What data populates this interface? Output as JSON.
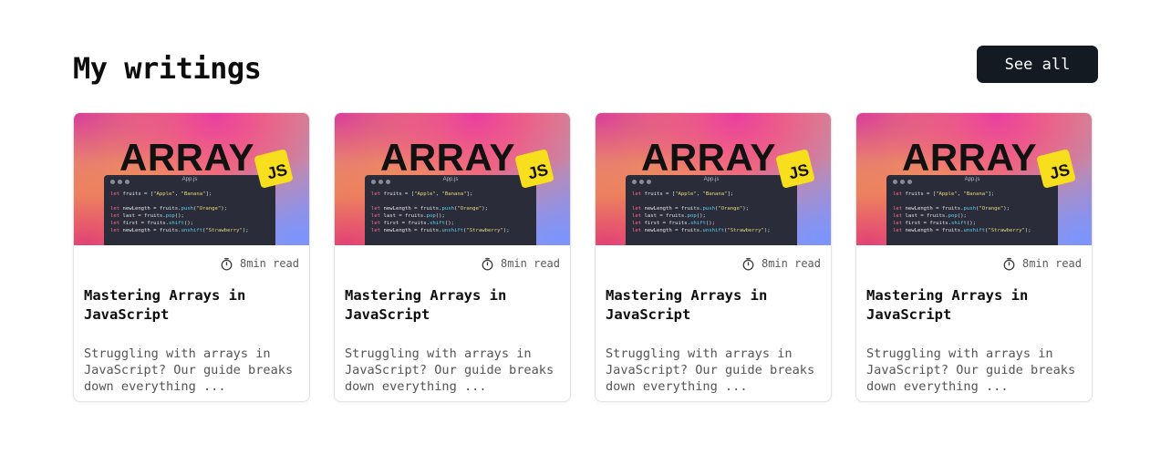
{
  "section": {
    "title": "My writings",
    "see_all_label": "See all"
  },
  "cards": [
    {
      "thumbnail": {
        "heading": "ARRAY",
        "badge": "JS",
        "filename": "App.js",
        "code": [
          "let fruits = [\"Apple\", \"Banana\"];",
          "",
          "let newLength = fruits.push(\"Orange\");",
          "let last = fruits.pop();",
          "let first = fruits.shift();",
          "let newLength = fruits.unshift(\"Strawberry\");"
        ]
      },
      "read_time": "8min read",
      "title": "Mastering Arrays in JavaScript",
      "description": "Struggling with arrays in JavaScript? Our guide breaks down everything ..."
    },
    {
      "thumbnail": {
        "heading": "ARRAY",
        "badge": "JS",
        "filename": "App.js",
        "code": [
          "let fruits = [\"Apple\", \"Banana\"];",
          "",
          "let newLength = fruits.push(\"Orange\");",
          "let last = fruits.pop();",
          "let first = fruits.shift();",
          "let newLength = fruits.unshift(\"Strawberry\");"
        ]
      },
      "read_time": "8min read",
      "title": "Mastering Arrays in JavaScript",
      "description": "Struggling with arrays in JavaScript? Our guide breaks down everything ..."
    },
    {
      "thumbnail": {
        "heading": "ARRAY",
        "badge": "JS",
        "filename": "App.js",
        "code": [
          "let fruits = [\"Apple\", \"Banana\"];",
          "",
          "let newLength = fruits.push(\"Orange\");",
          "let last = fruits.pop();",
          "let first = fruits.shift();",
          "let newLength = fruits.unshift(\"Strawberry\");"
        ]
      },
      "read_time": "8min read",
      "title": "Mastering Arrays in JavaScript",
      "description": "Struggling with arrays in JavaScript? Our guide breaks down everything ..."
    },
    {
      "thumbnail": {
        "heading": "ARRAY",
        "badge": "JS",
        "filename": "App.js",
        "code": [
          "let fruits = [\"Apple\", \"Banana\"];",
          "",
          "let newLength = fruits.push(\"Orange\");",
          "let last = fruits.pop();",
          "let first = fruits.shift();",
          "let newLength = fruits.unshift(\"Strawberry\");"
        ]
      },
      "read_time": "8min read",
      "title": "Mastering Arrays in JavaScript",
      "description": "Struggling with arrays in JavaScript? Our guide breaks down everything ..."
    }
  ],
  "icons": {
    "read_time": "timer-icon",
    "window_controls": "window-dots-icon"
  },
  "colors": {
    "button_bg": "#141a22",
    "button_text": "#ffffff",
    "js_badge": "#f7df1e",
    "code_bg": "#2a2c3a"
  }
}
